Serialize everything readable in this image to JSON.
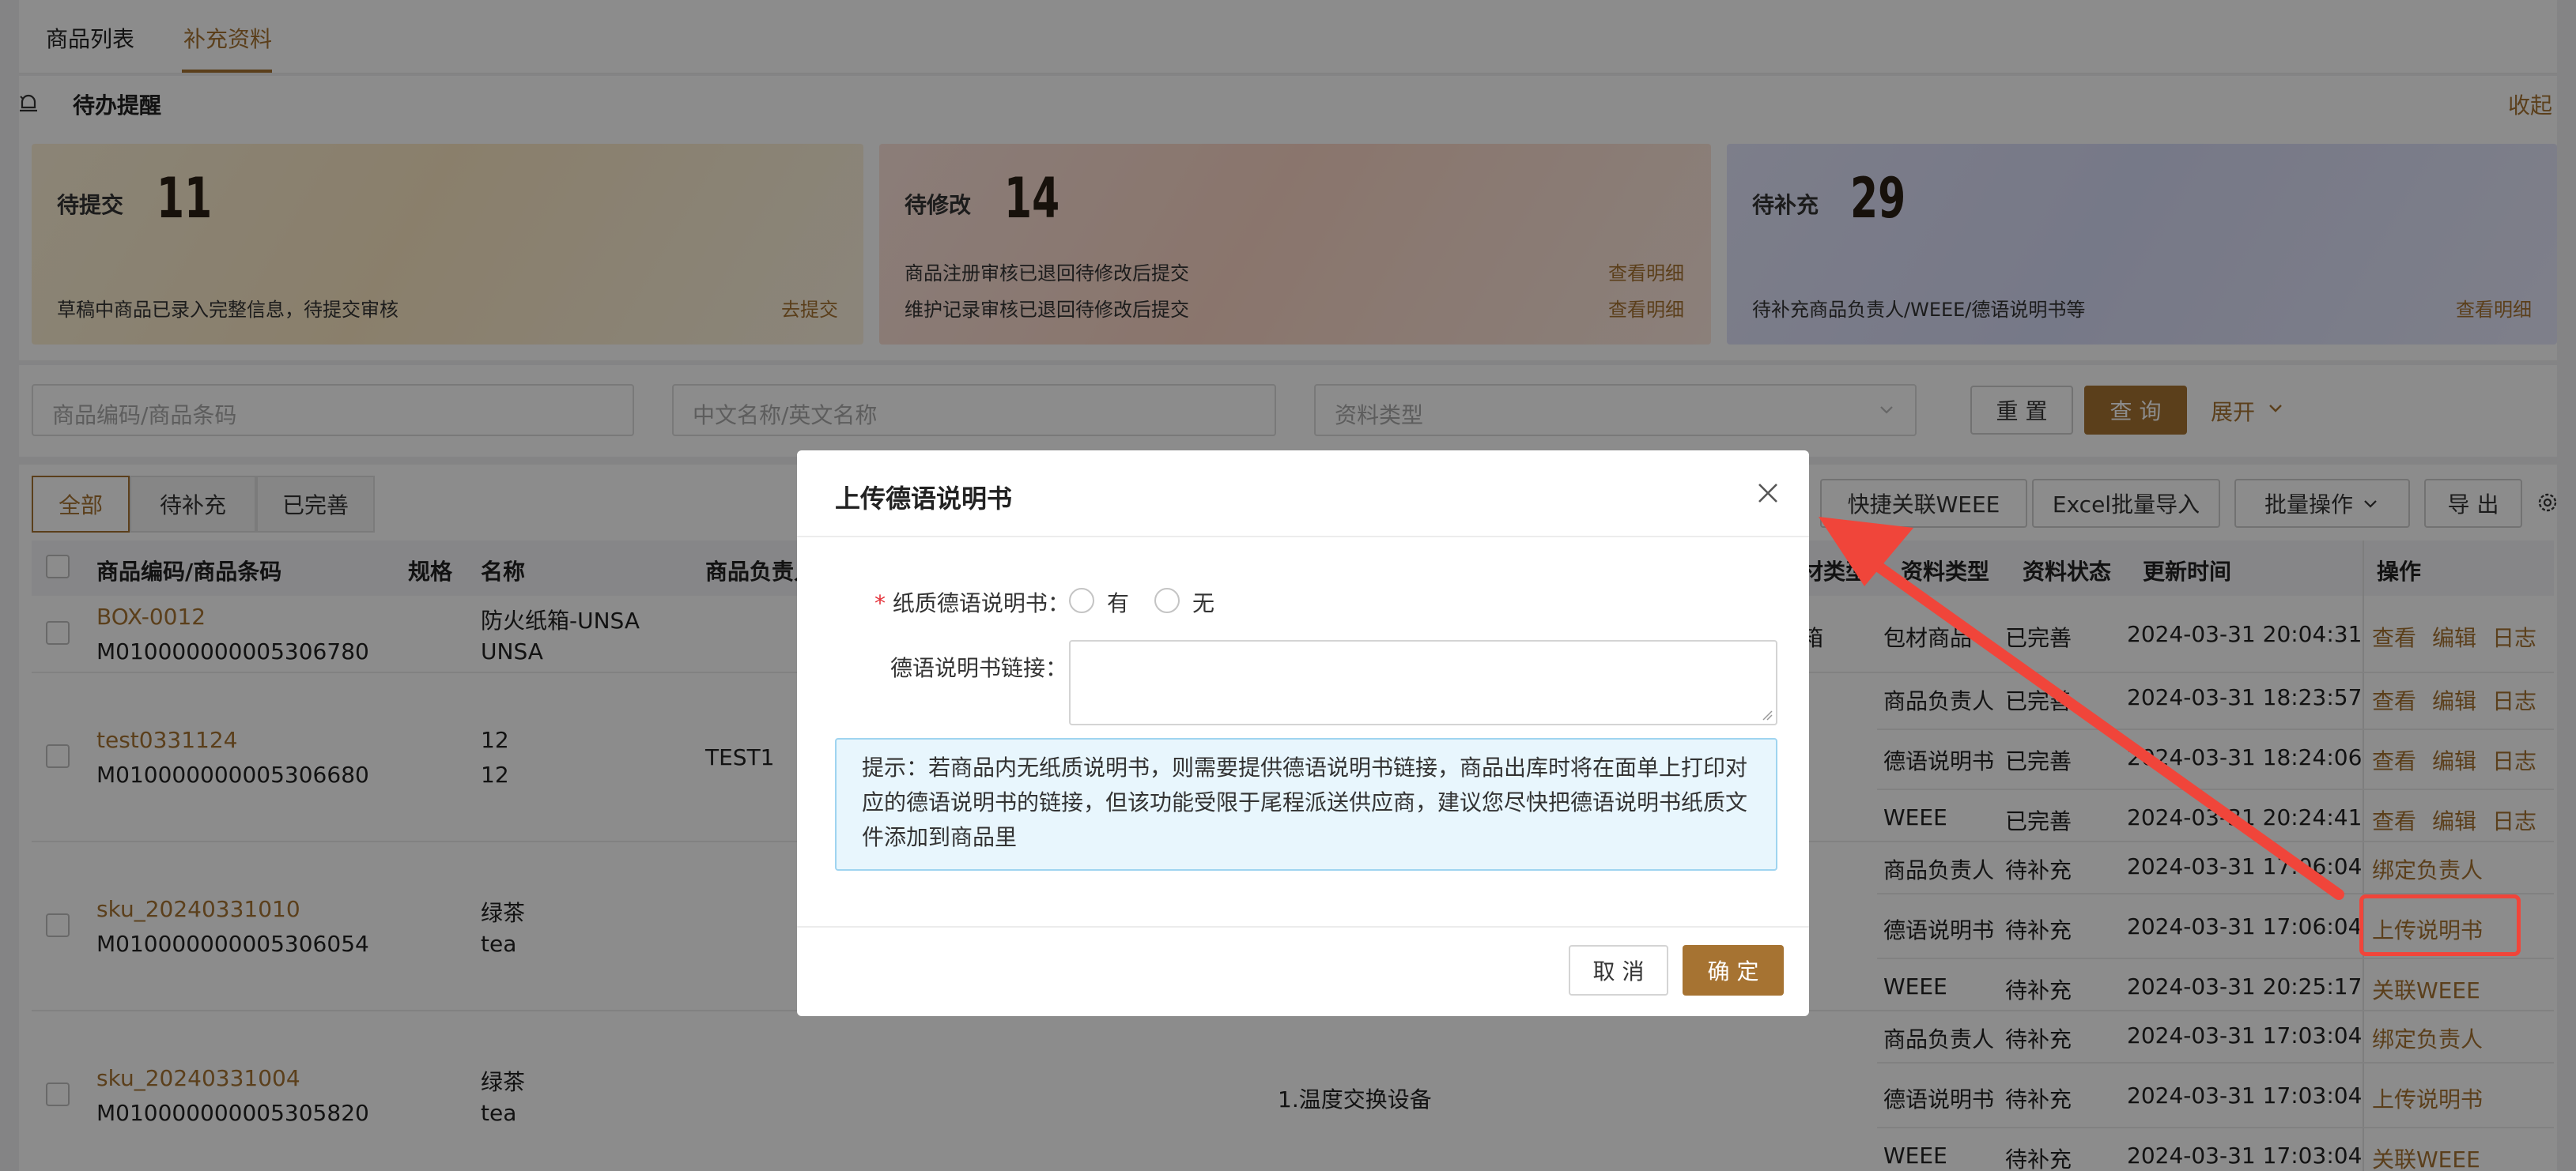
{
  "top_tabs": [
    "商品列表",
    "补充资料"
  ],
  "todo": {
    "title": "待办提醒",
    "collapse": "收起",
    "cards": [
      {
        "label": "待提交",
        "count": "11",
        "lines": [
          {
            "text": "草稿中商品已录入完整信息，待提交审核",
            "link": "去提交"
          }
        ]
      },
      {
        "label": "待修改",
        "count": "14",
        "lines": [
          {
            "text": "商品注册审核已退回待修改后提交",
            "link": "查看明细"
          },
          {
            "text": "维护记录审核已退回待修改后提交",
            "link": "查看明细"
          }
        ]
      },
      {
        "label": "待补充",
        "count": "29",
        "lines": [
          {
            "text": "待补充商品负责人/WEEE/德语说明书等",
            "link": "查看明细"
          }
        ]
      }
    ]
  },
  "filters": {
    "code_placeholder": "商品编码/商品条码",
    "name_placeholder": "中文名称/英文名称",
    "type_placeholder": "资料类型",
    "reset": "重 置",
    "query": "查 询",
    "expand": "展开"
  },
  "segment_tabs": [
    "全部",
    "待补充",
    "已完善"
  ],
  "toolbar": {
    "quick_weee": "快捷关联WEEE",
    "excel_import": "Excel批量导入",
    "batch_ops": "批量操作",
    "export": "导 出"
  },
  "columns": {
    "code": "商品编码/商品条码",
    "spec": "规格",
    "name": "名称",
    "owner": "商品负责人",
    "material_type": "材类型",
    "doc_type": "资料类型",
    "doc_status": "资料状态",
    "updated": "更新时间",
    "ops": "操作"
  },
  "rows": [
    {
      "code": "BOX-0012",
      "barcode": "M010000000005306780",
      "name1": "防火纸箱-UNSA",
      "name2": "UNSA",
      "owner": "",
      "material": "箱",
      "subs": [
        {
          "type": "包材商品",
          "status": "已完善",
          "time": "2024-03-31 20:04:31",
          "ops": [
            "查看",
            "编辑",
            "日志"
          ]
        }
      ]
    },
    {
      "code": "test0331124",
      "barcode": "M010000000005306680",
      "name1": "12",
      "name2": "12",
      "owner": "TEST1",
      "material": "",
      "subs": [
        {
          "type": "商品负责人",
          "status": "已完善",
          "time": "2024-03-31 18:23:57",
          "ops": [
            "查看",
            "编辑",
            "日志"
          ]
        },
        {
          "type": "德语说明书",
          "status": "已完善",
          "time": "2024-03-31 18:24:06",
          "ops": [
            "查看",
            "编辑",
            "日志"
          ]
        },
        {
          "type": "WEEE",
          "status": "已完善",
          "time": "2024-03-31 20:24:41",
          "ops": [
            "查看",
            "编辑",
            "日志"
          ]
        }
      ]
    },
    {
      "code": "sku_20240331010",
      "barcode": "M010000000005306054",
      "name1": "绿茶",
      "name2": "tea",
      "owner": "",
      "material": "",
      "subs": [
        {
          "type": "商品负责人",
          "status": "待补充",
          "time": "2024-03-31 17:06:04",
          "ops": [
            "绑定负责人"
          ]
        },
        {
          "type": "德语说明书",
          "status": "待补充",
          "time": "2024-03-31 17:06:04",
          "ops": [
            "上传说明书"
          ]
        },
        {
          "type": "WEEE",
          "status": "待补充",
          "time": "2024-03-31 20:25:17",
          "ops": [
            "关联WEEE"
          ]
        }
      ]
    },
    {
      "code": "sku_20240331004",
      "barcode": "M010000000005305820",
      "name1": "绿茶",
      "name2": "tea",
      "owner": "",
      "material": "1.温度交换设备",
      "subs": [
        {
          "type": "商品负责人",
          "status": "待补充",
          "time": "2024-03-31 17:03:04",
          "ops": [
            "绑定负责人"
          ]
        },
        {
          "type": "德语说明书",
          "status": "待补充",
          "time": "2024-03-31 17:03:04",
          "ops": [
            "上传说明书"
          ]
        },
        {
          "type": "WEEE",
          "status": "待补充",
          "time": "2024-03-31 17:03:04",
          "ops": [
            "关联WEEE"
          ]
        }
      ]
    }
  ],
  "modal": {
    "title": "上传德语说明书",
    "paper_label": "纸质德语说明书：",
    "required_mark": "*",
    "opt_yes": "有",
    "opt_no": "无",
    "link_label": "德语说明书链接：",
    "tip": "提示：若商品内无纸质说明书，则需要提供德语说明书链接，商品出库时将在面单上打印对应的德语说明书的链接，但该功能受限于尾程派送供应商，建议您尽快把德语说明书纸质文件添加到商品里",
    "cancel": "取 消",
    "confirm": "确 定"
  },
  "colors": {
    "accent": "#a67332",
    "annotation": "#f0453a",
    "tip_bg": "#e8f6fd"
  }
}
